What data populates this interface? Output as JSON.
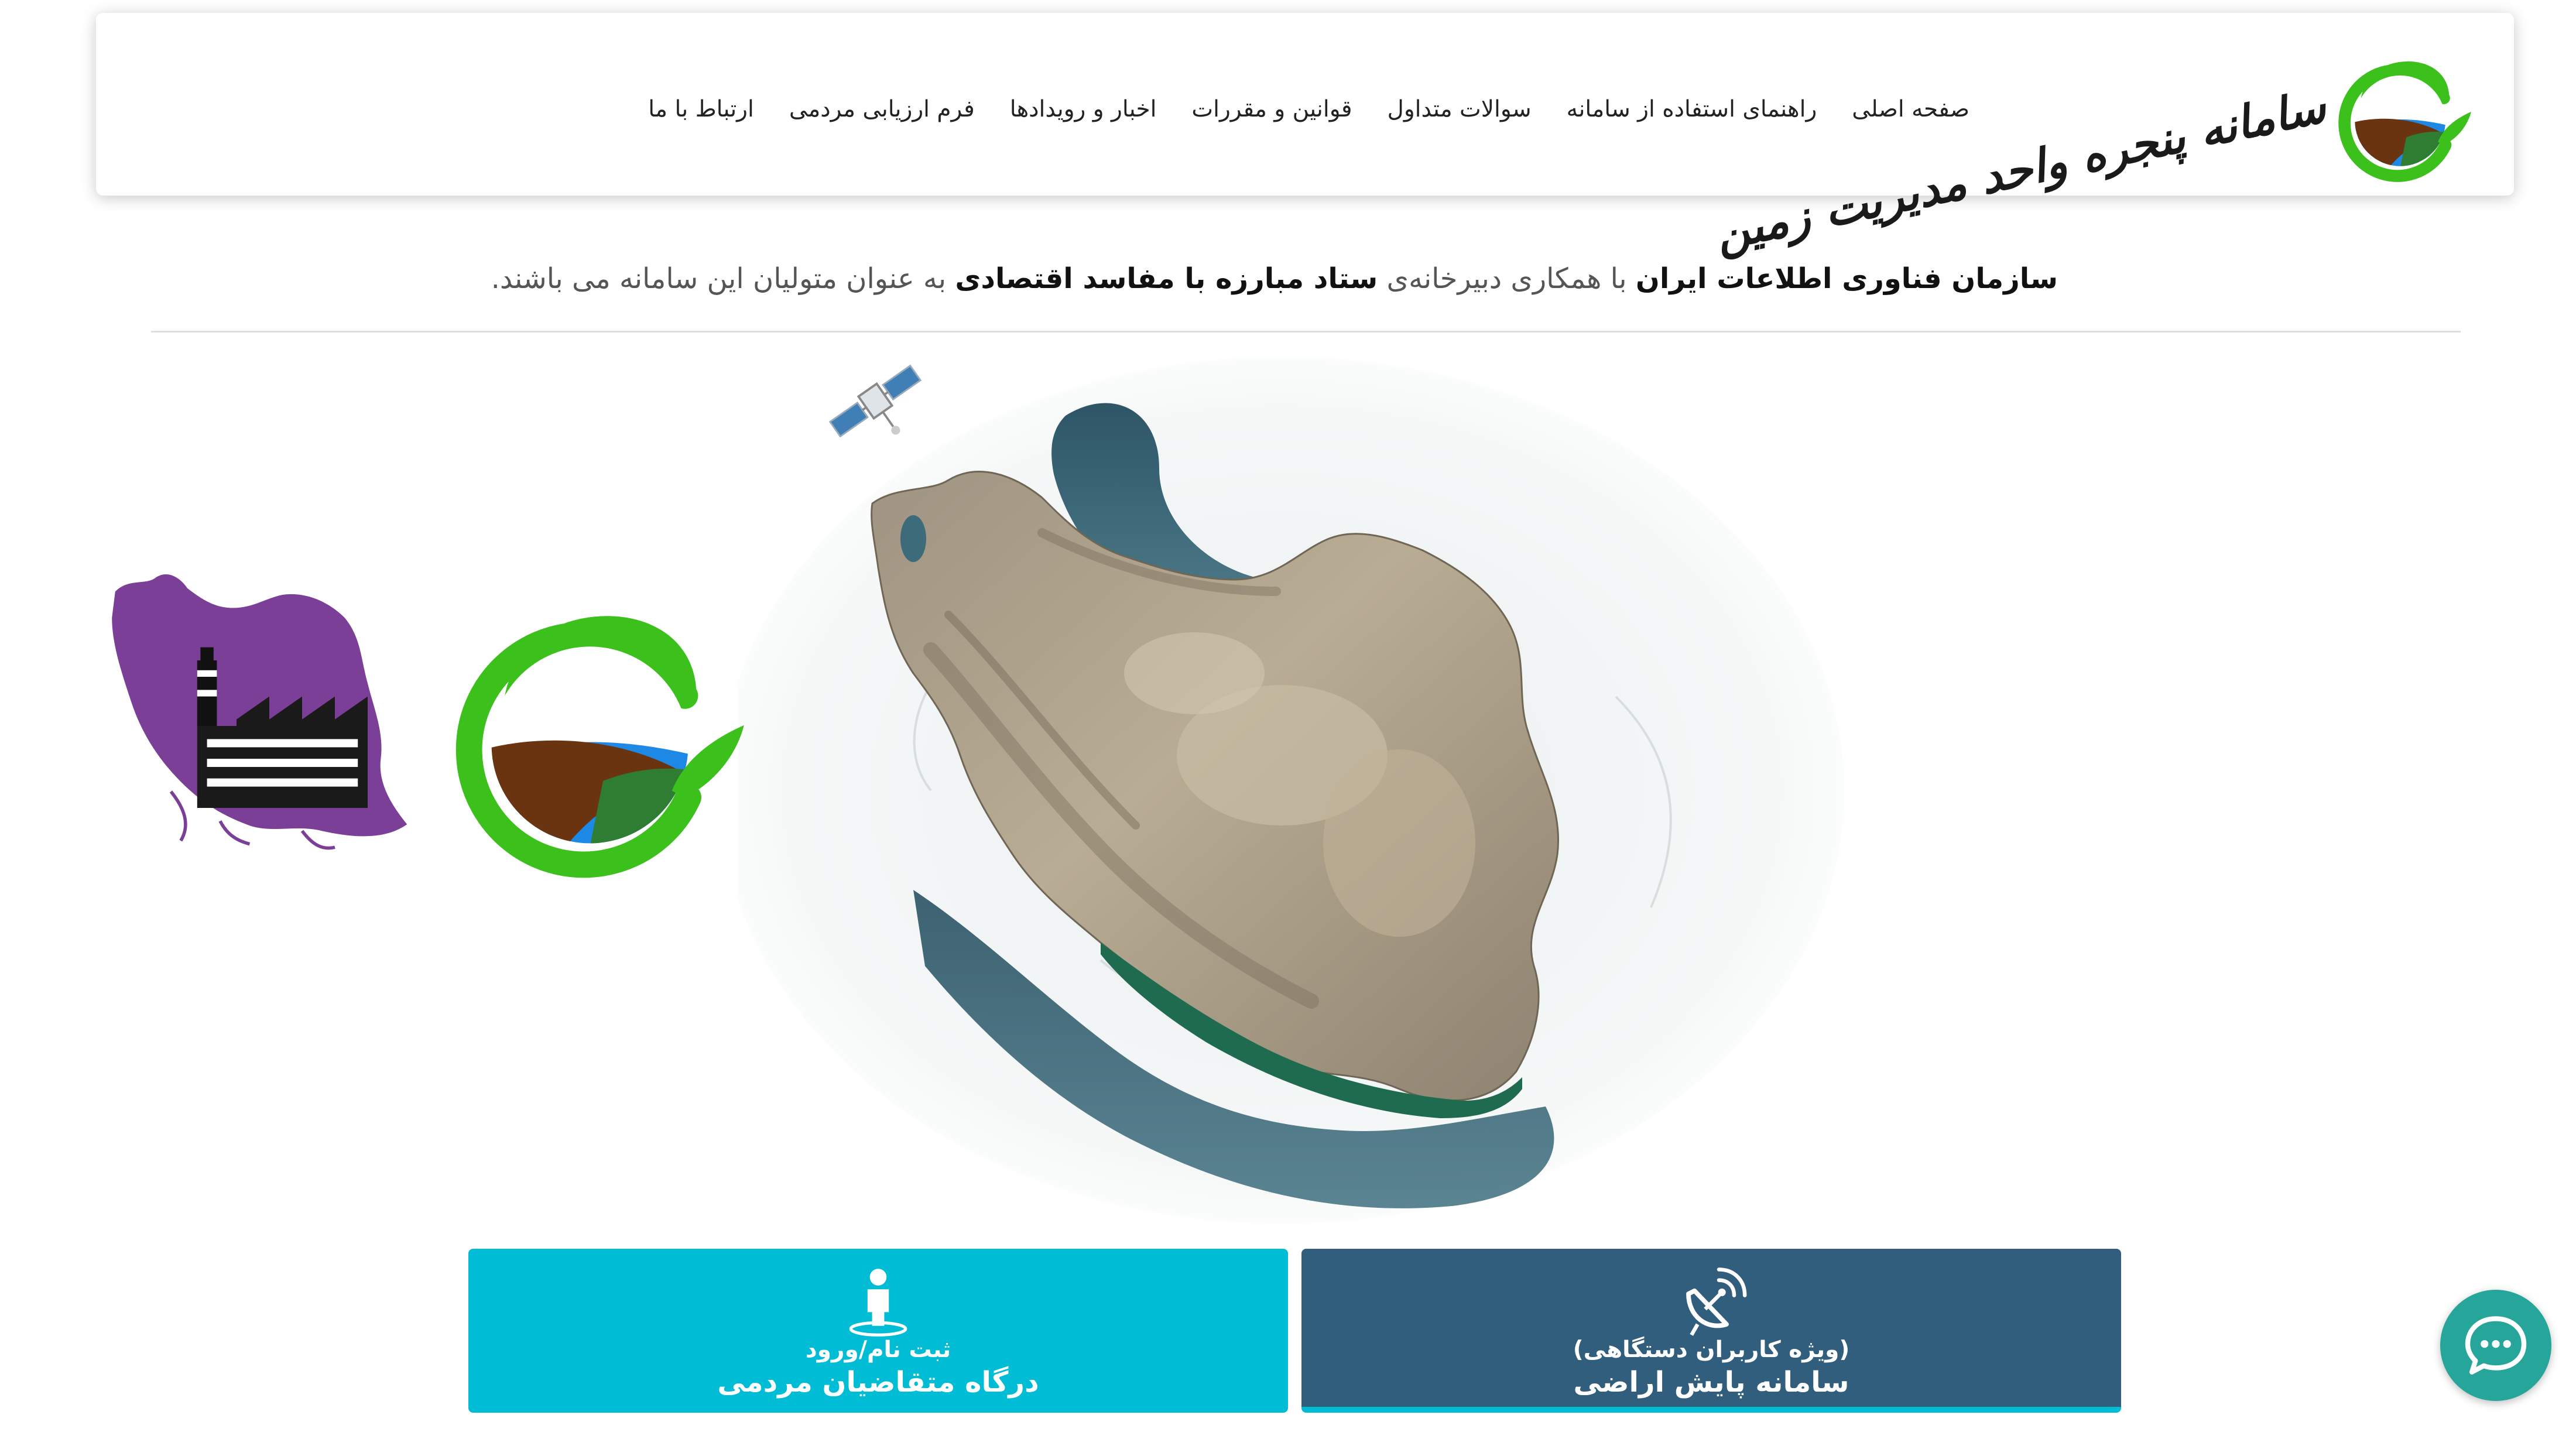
{
  "header": {
    "brand_title": "سامانه پنجره واحد مدیریت زمین",
    "brand_logo_icon": "leaf-field-logo-icon",
    "nav": [
      {
        "label": "صفحه اصلی"
      },
      {
        "label": "راهنمای استفاده از سامانه"
      },
      {
        "label": "سوالات متداول"
      },
      {
        "label": "قوانین و مقررات"
      },
      {
        "label": "اخبار و رویدادها"
      },
      {
        "label": "فرم ارزیابی مردمی"
      },
      {
        "label": "ارتباط با ما"
      }
    ]
  },
  "intro": {
    "org": "سازمان فناوری اطلاعات ایران",
    "with": " با همکاری دبیرخانه‌ی ",
    "hq": "ستاد مبارزه با مفاسد اقتصادی",
    "tail": " به عنوان متولیان این سامانه می باشند."
  },
  "hero": {
    "map_icon": "iran-satellite-map-icon",
    "satellite_icon": "satellite-icon",
    "logo_icon": "leaf-field-logo-icon",
    "factory_icon": "iran-factory-icon"
  },
  "cards": {
    "citizen": {
      "sub": "ثبت نام/ورود",
      "title": "درگاه متقاضیان مردمی",
      "icon": "person-location-icon"
    },
    "device": {
      "sub": "(ویژه کاربران دستگاهی)",
      "title": "سامانه پایش اراضی",
      "icon": "satellite-dish-icon"
    }
  },
  "chat": {
    "icon": "chat-bubble-icon"
  },
  "colors": {
    "logo_green": "#3cc11c",
    "field_brown": "#6b3410",
    "field_blue": "#1e88e5",
    "factory_purple": "#7b3f98",
    "citizen_card": "#00bcd4",
    "device_card": "#315e7d",
    "chat_teal": "#26a69a"
  }
}
